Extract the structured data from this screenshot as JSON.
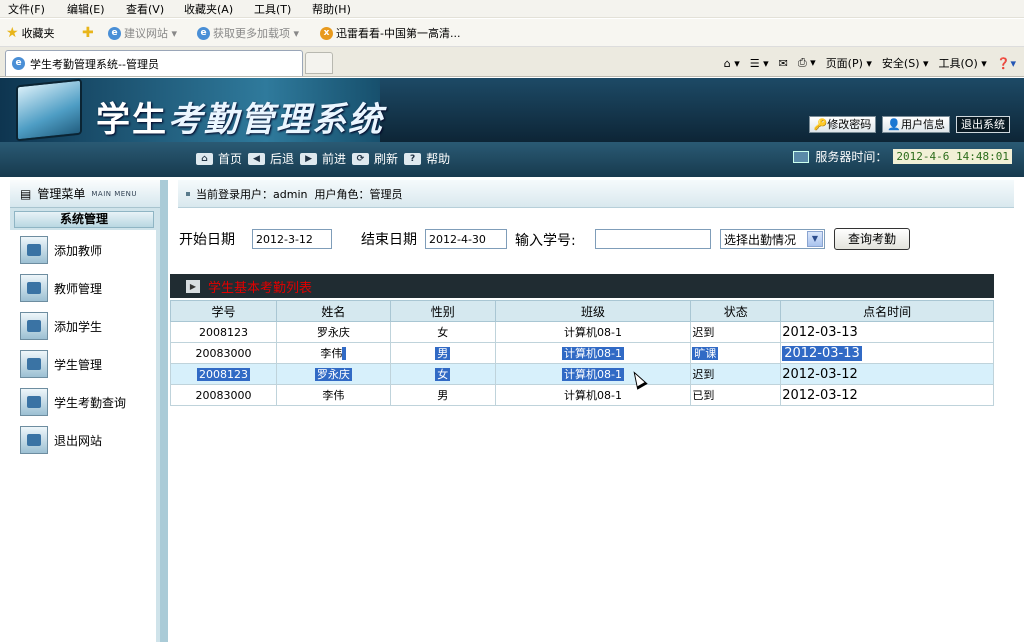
{
  "browser": {
    "menu": [
      "文件(F)",
      "编辑(E)",
      "查看(V)",
      "收藏夹(A)",
      "工具(T)",
      "帮助(H)"
    ],
    "favorites_label": "收藏夹",
    "fav_links": [
      "建议网站 ▾",
      "获取更多加载项 ▾",
      "迅雷看看-中国第一高清..."
    ],
    "tab_title": "学生考勤管理系统--管理员",
    "tools": [
      "页面(P) ▾",
      "安全(S) ▾",
      "工具(O) ▾"
    ]
  },
  "header": {
    "title_plain": "学生",
    "title_styled": "考勤管理系统",
    "buttons": [
      "修改密码",
      "用户信息",
      "退出系统"
    ]
  },
  "nav": {
    "links": [
      "首页",
      "后退",
      "前进",
      "刷新",
      "帮助"
    ],
    "server_label": "服务器时间：",
    "server_time": "2012-4-6 14:48:01"
  },
  "sidebar": {
    "title": "管理菜单",
    "title_en": "MAIN MENU",
    "section": "系统管理",
    "items": [
      "添加教师",
      "教师管理",
      "添加学生",
      "学生管理",
      "学生考勤查询",
      "退出网站"
    ]
  },
  "main": {
    "login_info": "当前登录用户：admin  用户角色：管理员",
    "start_label": "开始日期",
    "start_value": "2012-3-12",
    "end_label": "结束日期",
    "end_value": "2012-4-30",
    "sid_label": "输入学号:",
    "sid_value": "",
    "select_value": "选择出勤情况",
    "query_button": "查询考勤",
    "table_title": "学生基本考勤列表",
    "columns": [
      "学号",
      "姓名",
      "性别",
      "班级",
      "状态",
      "点名时间"
    ],
    "rows": [
      [
        "2008123",
        "罗永庆",
        "女",
        "计算机08-1",
        "迟到",
        "2012-03-13"
      ],
      [
        "20083000",
        "李伟",
        "男",
        "计算机08-1",
        "旷课",
        "2012-03-13"
      ],
      [
        "2008123",
        "罗永庆",
        "女",
        "计算机08-1",
        "迟到",
        "2012-03-12"
      ],
      [
        "20083000",
        "李伟",
        "男",
        "计算机08-1",
        "已到",
        "2012-03-12"
      ]
    ]
  }
}
